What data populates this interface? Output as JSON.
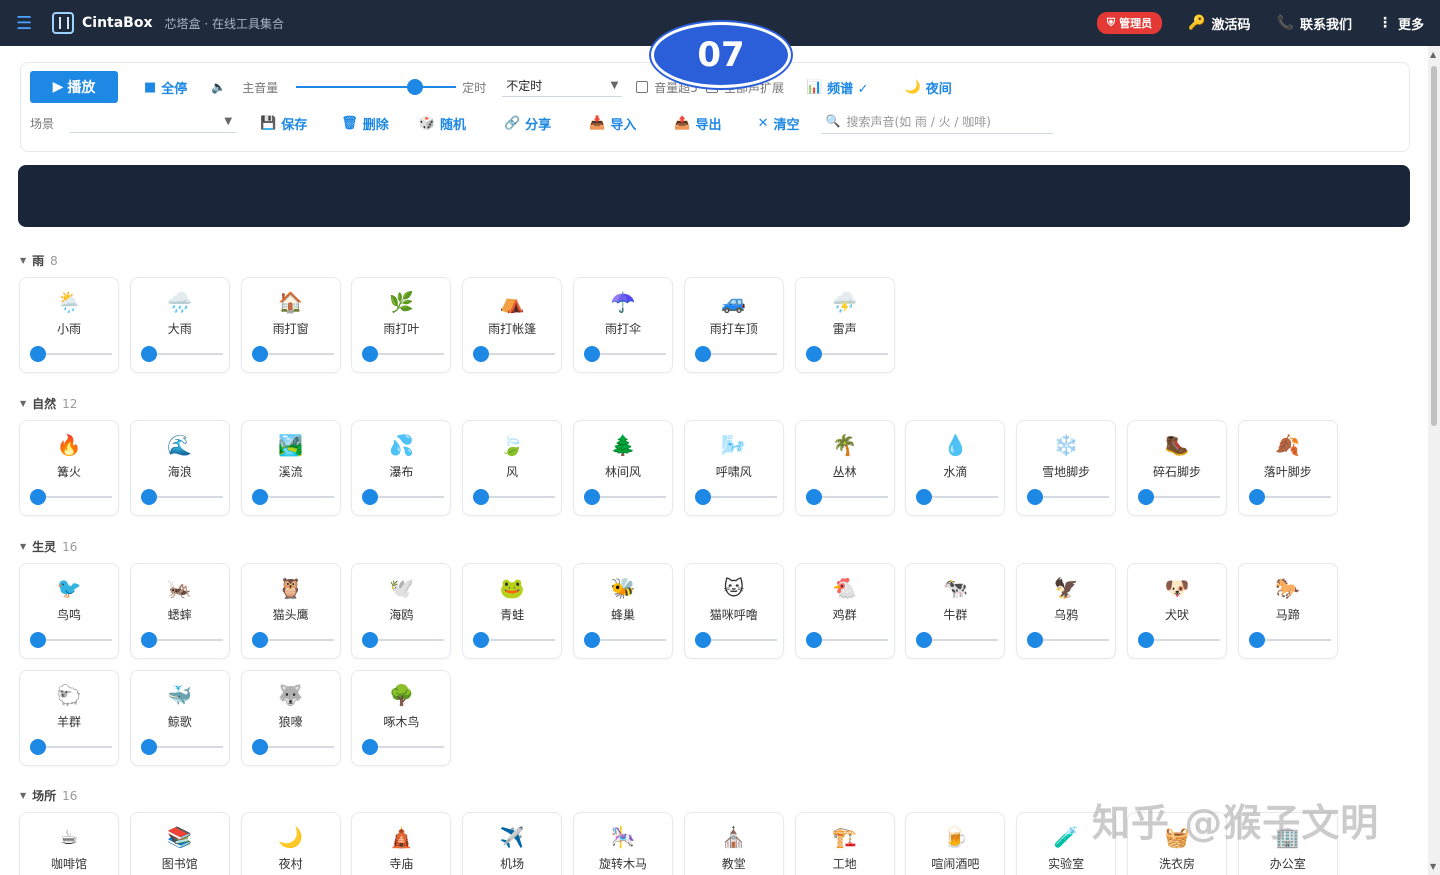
{
  "nav": {
    "brand": "CintaBox",
    "subtitle": "芯塔盒 · 在线工具集合",
    "admin": "管理员",
    "activate": "激活码",
    "contact": "联系我们",
    "more": "更多"
  },
  "overlay_badge": "07",
  "toolbar": {
    "play": "播放",
    "stop_all": "全停",
    "master_volume_label": "主音量",
    "master_volume": 0.77,
    "timer_label": "定时",
    "timer_value": "不定时",
    "check1": "音量超5",
    "check2": "全部声扩展",
    "spectrum": "频谱 ✓",
    "night": "夜间",
    "scene_label": "场景",
    "save": "保存",
    "delete": "删除",
    "random": "随机",
    "share": "分享",
    "import": "导入",
    "export": "导出",
    "clear": "清空",
    "search_placeholder": "搜索声音(如 雨 / 火 / 咖啡)"
  },
  "sections": [
    {
      "name": "雨",
      "count": "8",
      "items": [
        {
          "label": "小雨",
          "icon": "🌦️"
        },
        {
          "label": "大雨",
          "icon": "🌧️"
        },
        {
          "label": "雨打窗",
          "icon": "🏠"
        },
        {
          "label": "雨打叶",
          "icon": "🌿"
        },
        {
          "label": "雨打帐篷",
          "icon": "⛺"
        },
        {
          "label": "雨打伞",
          "icon": "☂️"
        },
        {
          "label": "雨打车顶",
          "icon": "🚙"
        },
        {
          "label": "雷声",
          "icon": "⛈️"
        }
      ]
    },
    {
      "name": "自然",
      "count": "12",
      "items": [
        {
          "label": "篝火",
          "icon": "🔥"
        },
        {
          "label": "海浪",
          "icon": "🌊"
        },
        {
          "label": "溪流",
          "icon": "🏞️"
        },
        {
          "label": "瀑布",
          "icon": "💦"
        },
        {
          "label": "风",
          "icon": "🍃"
        },
        {
          "label": "林间风",
          "icon": "🌲"
        },
        {
          "label": "呼啸风",
          "icon": "🌬️"
        },
        {
          "label": "丛林",
          "icon": "🌴"
        },
        {
          "label": "水滴",
          "icon": "💧"
        },
        {
          "label": "雪地脚步",
          "icon": "❄️"
        },
        {
          "label": "碎石脚步",
          "icon": "🥾"
        },
        {
          "label": "落叶脚步",
          "icon": "🍂"
        }
      ]
    },
    {
      "name": "生灵",
      "count": "16",
      "items": [
        {
          "label": "鸟鸣",
          "icon": "🐦"
        },
        {
          "label": "蟋蟀",
          "icon": "🦗"
        },
        {
          "label": "猫头鹰",
          "icon": "🦉"
        },
        {
          "label": "海鸥",
          "icon": "🕊️"
        },
        {
          "label": "青蛙",
          "icon": "🐸"
        },
        {
          "label": "蜂巢",
          "icon": "🐝"
        },
        {
          "label": "猫咪呼噜",
          "icon": "🐱"
        },
        {
          "label": "鸡群",
          "icon": "🐔"
        },
        {
          "label": "牛群",
          "icon": "🐄"
        },
        {
          "label": "乌鸦",
          "icon": "🦅"
        },
        {
          "label": "犬吠",
          "icon": "🐶"
        },
        {
          "label": "马蹄",
          "icon": "🐎"
        },
        {
          "label": "羊群",
          "icon": "🐑"
        },
        {
          "label": "鲸歌",
          "icon": "🐳"
        },
        {
          "label": "狼嚎",
          "icon": "🐺"
        },
        {
          "label": "啄木鸟",
          "icon": "🌳"
        }
      ]
    },
    {
      "name": "场所",
      "count": "16",
      "items": [
        {
          "label": "咖啡馆",
          "icon": "☕"
        },
        {
          "label": "图书馆",
          "icon": "📚"
        },
        {
          "label": "夜村",
          "icon": "🌙"
        },
        {
          "label": "寺庙",
          "icon": "🛕"
        },
        {
          "label": "机场",
          "icon": "✈️"
        },
        {
          "label": "旋转木马",
          "icon": "🎠"
        },
        {
          "label": "教堂",
          "icon": "⛪"
        },
        {
          "label": "工地",
          "icon": "🏗️"
        },
        {
          "label": "喧闹酒吧",
          "icon": "🍺"
        },
        {
          "label": "实验室",
          "icon": "🧪"
        },
        {
          "label": "洗衣房",
          "icon": "🧺"
        },
        {
          "label": "办公室",
          "icon": "🏢"
        }
      ]
    }
  ],
  "watermark": "知乎 @猴子文明",
  "colors": {
    "accent": "#1e88e5",
    "navbar": "#1f2a3c",
    "banner": "#1b2539",
    "admin": "#e53935"
  }
}
